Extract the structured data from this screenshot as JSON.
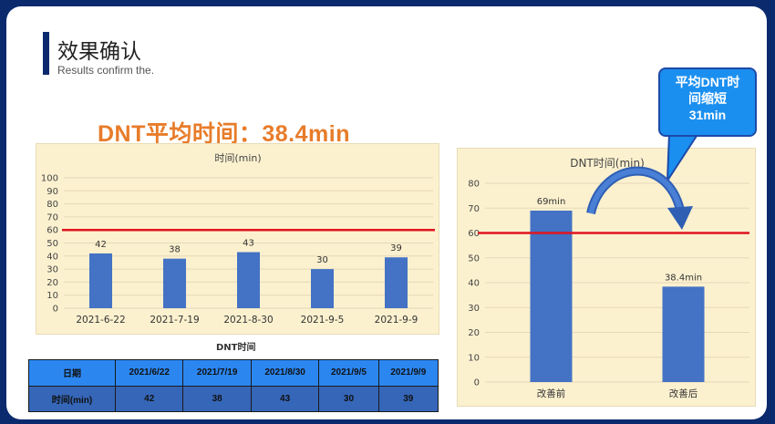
{
  "page": {
    "title": "效果确认",
    "subtitle": "Results confirm the.",
    "headline": "DNT平均时间：38.4min"
  },
  "colors": {
    "bar": "#4472c4",
    "target_line": "#e0141e",
    "headline": "#e87c2a",
    "callout": "#1b8ff0"
  },
  "chart_data": [
    {
      "type": "bar",
      "title": "时间(min)",
      "categories": [
        "2021-6-22",
        "2021-7-19",
        "2021-8-30",
        "2021-9-5",
        "2021-9-9"
      ],
      "values": [
        42,
        38,
        43,
        30,
        39
      ],
      "data_labels": [
        "42",
        "38",
        "43",
        "30",
        "39"
      ],
      "ylim": [
        0,
        100
      ],
      "yticks": [
        "0",
        "10",
        "20",
        "30",
        "40",
        "50",
        "60",
        "70",
        "80",
        "90",
        "100"
      ],
      "reference_line": 60,
      "grid": true
    },
    {
      "type": "bar",
      "title": "DNT时间(min)",
      "categories": [
        "改善前",
        "改善后"
      ],
      "values": [
        69,
        38.4
      ],
      "data_labels": [
        "69min",
        "38.4min"
      ],
      "ylim": [
        0,
        80
      ],
      "yticks": [
        "0",
        "10",
        "20",
        "30",
        "40",
        "50",
        "60",
        "70",
        "80"
      ],
      "reference_line": 60,
      "grid": true
    }
  ],
  "table": {
    "caption": "DNT时间",
    "header": [
      "日期",
      "2021/6/22",
      "2021/7/19",
      "2021/8/30",
      "2021/9/5",
      "2021/9/9"
    ],
    "row": [
      "时间(min)",
      "42",
      "38",
      "43",
      "30",
      "39"
    ]
  },
  "callout": {
    "lines": [
      "平均DNT时",
      "间缩短",
      "31min"
    ]
  }
}
